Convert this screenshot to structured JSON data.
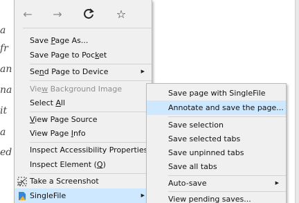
{
  "background_fragments": [
    "a",
    "fr",
    "an",
    "na",
    "it",
    "a",
    "ed"
  ],
  "nav": {
    "back_icon": "arrow-left-icon",
    "forward_icon": "arrow-right-icon",
    "reload_icon": "reload-icon",
    "bookmark_icon": "star-icon",
    "glyphs": {
      "back": "←",
      "forward": "→",
      "reload": "C",
      "bookmark": "☆"
    }
  },
  "menu": {
    "save_page_as": {
      "pre": "Save ",
      "u": "P",
      "post": "age As..."
    },
    "save_to_pocket": {
      "pre": "Save Page to Poc",
      "u": "k",
      "post": "et"
    },
    "send_to_device": {
      "pre": "Se",
      "u": "n",
      "post": "d Page to Device"
    },
    "view_bg_image": {
      "pre": "Vie",
      "u": "w",
      "post": " Background Image"
    },
    "select_all": {
      "pre": "Select ",
      "u": "A",
      "post": "ll"
    },
    "view_source": {
      "pre": "",
      "u": "V",
      "post": "iew Page Source"
    },
    "view_info": {
      "pre": "View Page ",
      "u": "I",
      "post": "nfo"
    },
    "inspect_accessibility": "Inspect Accessibility Properties",
    "inspect_element": {
      "pre": "Inspect Element (",
      "u": "Q",
      "post": ")"
    },
    "screenshot": "Take a Screenshot",
    "singlefile": "SingleFile",
    "submenu_arrow": "▶"
  },
  "submenu": {
    "items": [
      "Save page with SingleFile",
      "Annotate and save the page...",
      "Save selection",
      "Save selected tabs",
      "Save unpinned tabs",
      "Save all tabs",
      "Auto-save",
      "View pending saves..."
    ]
  },
  "colors": {
    "selected": "#cde8ff",
    "menu_bg": "#f0f0f0"
  }
}
